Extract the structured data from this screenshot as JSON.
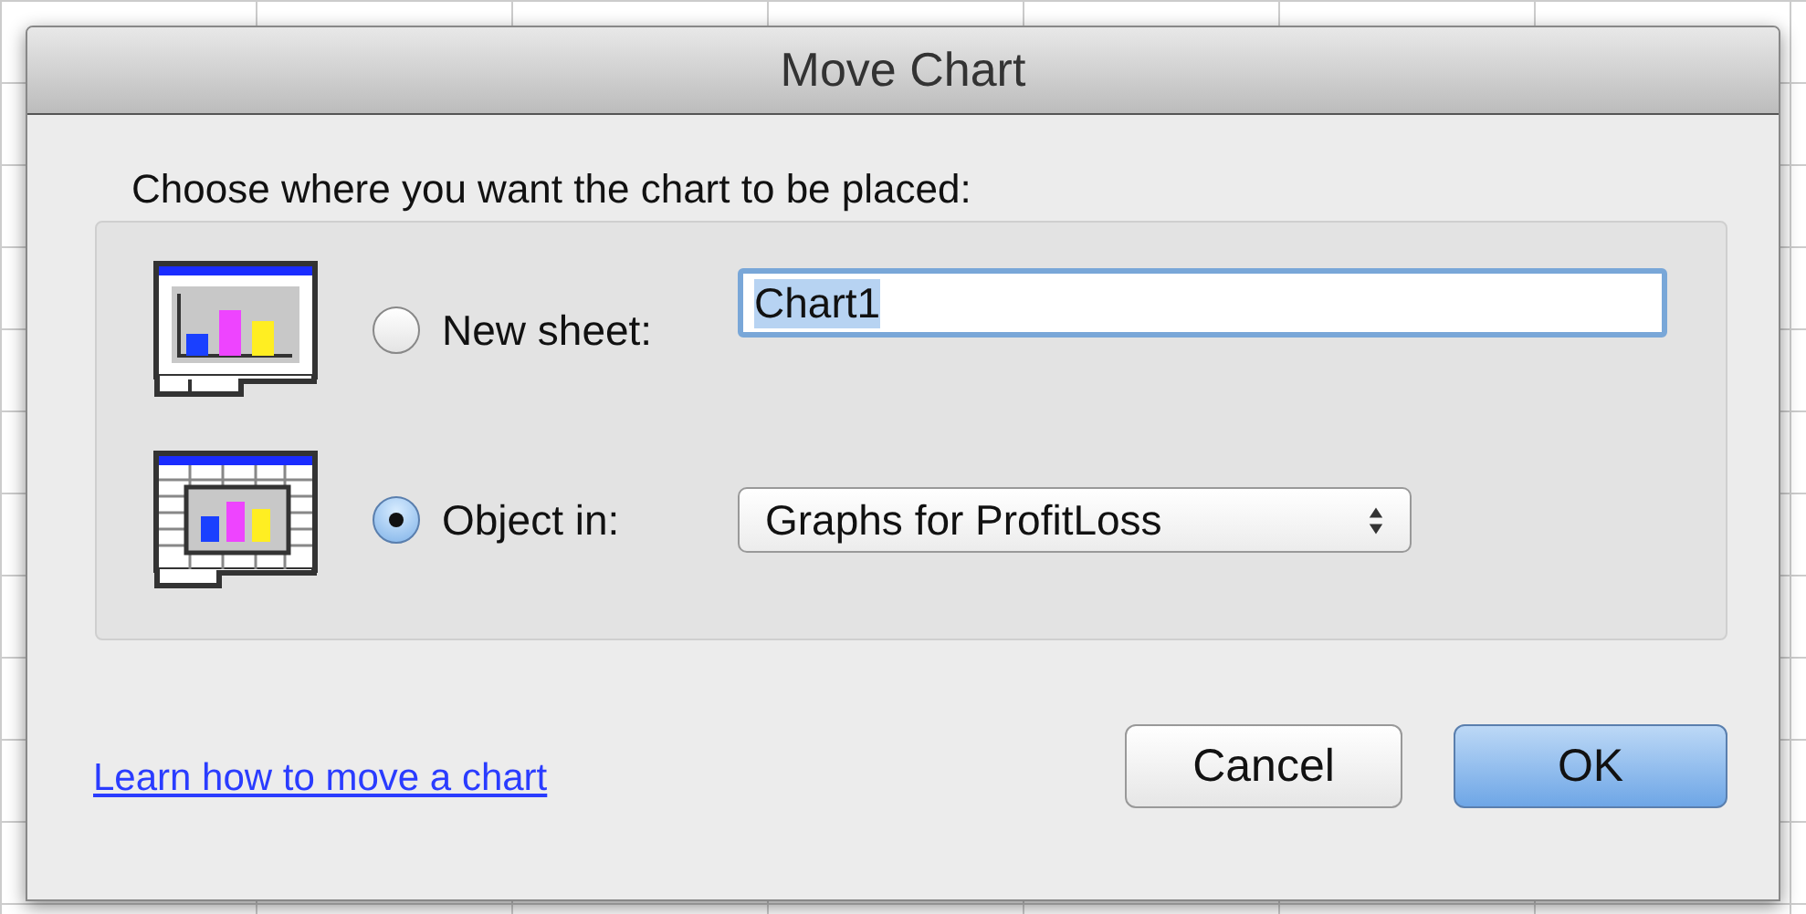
{
  "window": {
    "title": "Move Chart"
  },
  "prompt": "Choose where you want the chart to be placed:",
  "options": [
    {
      "kind": "text",
      "label": "New sheet:",
      "selected": false,
      "value": "Chart1",
      "focused": true
    },
    {
      "kind": "select",
      "label": "Object in:",
      "selected": true,
      "value": "Graphs for ProfitLoss"
    }
  ],
  "link": "Learn how to move a chart",
  "buttons": [
    {
      "label": "Cancel",
      "default": false
    },
    {
      "label": "OK",
      "default": true
    }
  ]
}
